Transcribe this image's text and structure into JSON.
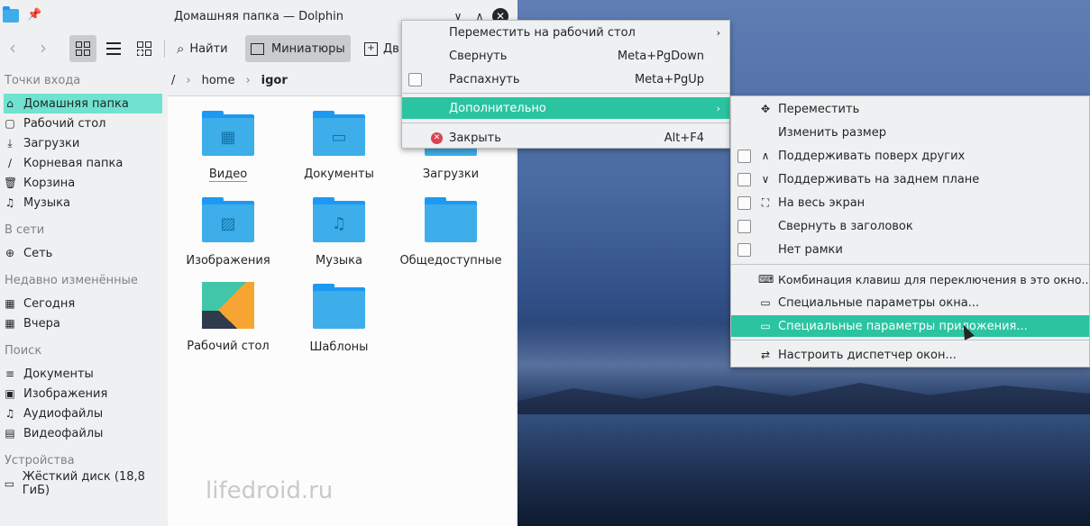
{
  "window": {
    "title": "Домашняя папка — Dolphin",
    "pin_glyph": "📌",
    "min_glyph": "∨",
    "max_glyph": "∧",
    "close_glyph": "✕"
  },
  "toolbar": {
    "back": "‹",
    "forward": "›",
    "find_label": "Найти",
    "thumbnails_label": "Миниатюры",
    "split_label": "Дв"
  },
  "sidebar": {
    "places_header": "Точки входа",
    "places": [
      {
        "label": "Домашняя папка",
        "icon": "⌂"
      },
      {
        "label": "Рабочий стол",
        "icon": "▢"
      },
      {
        "label": "Загрузки",
        "icon": "⤓"
      },
      {
        "label": "Корневая папка",
        "icon": "∕"
      },
      {
        "label": "Корзина",
        "icon": "🗑"
      },
      {
        "label": "Музыка",
        "icon": "♫"
      }
    ],
    "network_header": "В сети",
    "network": [
      {
        "label": "Сеть",
        "icon": "⊕"
      }
    ],
    "recent_header": "Недавно изменённые",
    "recent": [
      {
        "label": "Сегодня",
        "icon": "▦"
      },
      {
        "label": "Вчера",
        "icon": "▦"
      }
    ],
    "search_header": "Поиск",
    "search": [
      {
        "label": "Документы",
        "icon": "≡"
      },
      {
        "label": "Изображения",
        "icon": "▣"
      },
      {
        "label": "Аудиофайлы",
        "icon": "♫"
      },
      {
        "label": "Видеофайлы",
        "icon": "▤"
      }
    ],
    "devices_header": "Устройства",
    "devices": [
      {
        "label": "Жёсткий диск (18,8 ГиБ)",
        "icon": "▭"
      }
    ]
  },
  "breadcrumb": {
    "root": "/",
    "sep": "›",
    "home": "home",
    "current": "igor"
  },
  "files": [
    {
      "label": "Видео",
      "glyph": "▦"
    },
    {
      "label": "Документы",
      "glyph": "▭"
    },
    {
      "label": "Загрузки",
      "glyph": ""
    },
    {
      "label": "Изображения",
      "glyph": "▨"
    },
    {
      "label": "Музыка",
      "glyph": "♫"
    },
    {
      "label": "Общедоступные",
      "glyph": ""
    },
    {
      "label": "Рабочий стол",
      "glyph": ""
    },
    {
      "label": "Шаблоны",
      "glyph": ""
    }
  ],
  "watermark": "lifedroid.ru",
  "menu1": {
    "items": [
      {
        "label": "Переместить на рабочий стол",
        "shortcut": ""
      },
      {
        "label": "Свернуть",
        "shortcut": "Meta+PgDown"
      },
      {
        "label": "Распахнуть",
        "shortcut": "Meta+PgUp"
      },
      {
        "label": "Дополнительно",
        "shortcut": ""
      },
      {
        "label": "Закрыть",
        "shortcut": "Alt+F4"
      }
    ],
    "arrow": "›",
    "close_x": "✕"
  },
  "menu2": {
    "items": [
      {
        "label": "Переместить",
        "icon": "✥"
      },
      {
        "label": "Изменить размер",
        "icon": ""
      },
      {
        "label": "Поддерживать поверх других",
        "icon": "∧"
      },
      {
        "label": "Поддерживать на заднем плане",
        "icon": "∨"
      },
      {
        "label": "На весь экран",
        "icon": "⛶"
      },
      {
        "label": "Свернуть в заголовок",
        "icon": ""
      },
      {
        "label": "Нет рамки",
        "icon": ""
      },
      {
        "label": "Комбинация клавиш для переключения в это окно...",
        "icon": "⌨"
      },
      {
        "label": "Специальные параметры окна...",
        "icon": "▭"
      },
      {
        "label": "Специальные параметры приложения...",
        "icon": "▭"
      },
      {
        "label": "Настроить диспетчер окон...",
        "icon": "⇄"
      }
    ]
  },
  "colors": {
    "accent": "#2bc4a0",
    "folder": "#3daee9",
    "selection": "#6fe3cf",
    "close_red": "#da4453"
  }
}
